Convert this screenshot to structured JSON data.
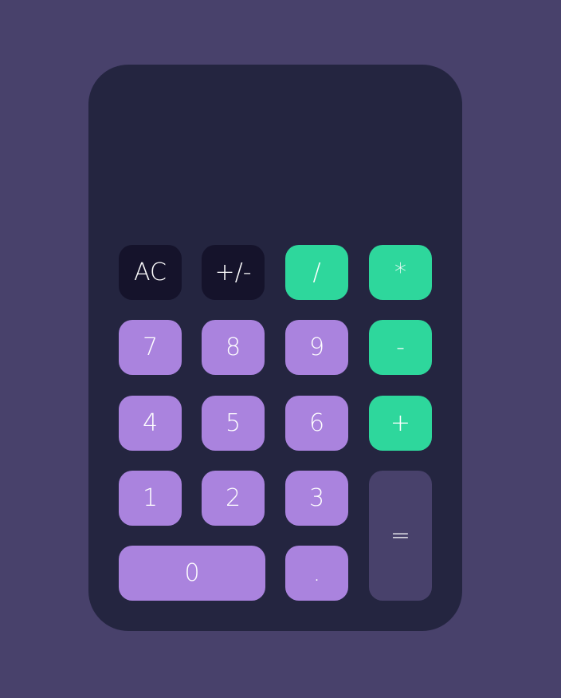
{
  "display": {
    "value": ""
  },
  "buttons": {
    "clear": "AC",
    "negate": "+/-",
    "divide": "/",
    "multiply": "*",
    "seven": "7",
    "eight": "8",
    "nine": "9",
    "subtract": "-",
    "four": "4",
    "five": "5",
    "six": "6",
    "add": "+",
    "one": "1",
    "two": "2",
    "three": "3",
    "equals": "=",
    "zero": "0",
    "decimal": "."
  },
  "colors": {
    "background": "#48416b",
    "body": "#242540",
    "function_key": "#15132b",
    "operator_key": "#2ed79c",
    "digit_key": "#aa83de",
    "equals_key": "#48416b"
  }
}
